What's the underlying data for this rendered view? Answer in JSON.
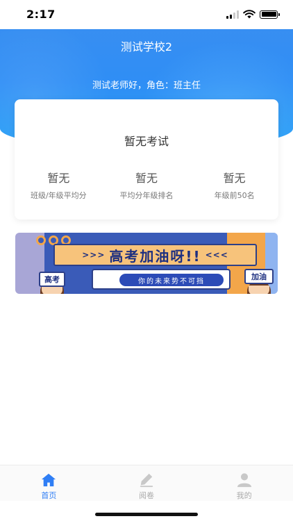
{
  "status_bar": {
    "time": "2:17",
    "icons": [
      "signal-icon",
      "wifi-icon",
      "battery-icon"
    ]
  },
  "header": {
    "school_name": "测试学校2",
    "greeting": "测试老师好，角色：班主任",
    "accent": "#2f8ef5"
  },
  "exam_card": {
    "title": "暂无考试",
    "stats": [
      {
        "value": "暂无",
        "label": "班级/年级平均分"
      },
      {
        "value": "暂无",
        "label": "平均分年级排名"
      },
      {
        "value": "暂无",
        "label": "年级前50名"
      }
    ]
  },
  "banner": {
    "left_arrows": ">>>",
    "headline": "高考加油呀!!",
    "right_arrows": "<<<",
    "subtitle": "你的未来势不可挡",
    "left_sign": "高考",
    "right_sign": "加油"
  },
  "tabbar": {
    "active_color": "#2f7ef5",
    "items": [
      {
        "label": "首页",
        "icon": "home-icon",
        "active": true
      },
      {
        "label": "阅卷",
        "icon": "pen-icon",
        "active": false
      },
      {
        "label": "我的",
        "icon": "person-icon",
        "active": false
      }
    ]
  }
}
